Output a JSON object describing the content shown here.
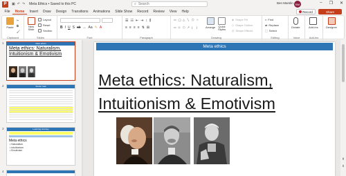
{
  "app": {
    "logo_letter": "P",
    "window_title": "Meta Ethics • Saved to this PC",
    "search_placeholder": "Search",
    "user_name": "Ben Marslin",
    "user_initials": "BM",
    "minimize": "–",
    "restore": "❐",
    "close": "✕"
  },
  "tabs": [
    "File",
    "Home",
    "Insert",
    "Draw",
    "Design",
    "Transitions",
    "Animations",
    "Slide Show",
    "Record",
    "Review",
    "View",
    "Help"
  ],
  "active_tab": "Home",
  "record_label": "Record",
  "share_label": "Share",
  "ribbon": {
    "clipboard": {
      "label": "Clipboard",
      "paste": "Paste"
    },
    "slides": {
      "label": "Slides",
      "new": "New\nSlide",
      "layout": "Layout",
      "reset": "Reset",
      "section": "Section"
    },
    "font": {
      "label": "Font"
    },
    "paragraph": {
      "label": "Paragraph"
    },
    "drawing": {
      "label": "Drawing",
      "arrange": "Arrange",
      "quick_styles": "Quick\nStyles",
      "shape_fill": "Shape Fill",
      "shape_outline": "Shape Outline",
      "shape_effects": "Shape Effects"
    },
    "editing": {
      "label": "Editing",
      "find": "Find",
      "replace": "Replace",
      "select": "Select"
    },
    "voice": {
      "label": "Voice",
      "dictate": "Dictate"
    },
    "addins": {
      "label": "Add-ins",
      "addins": "Add-ins"
    },
    "designer": {
      "label": "",
      "designer": "Designer"
    }
  },
  "thumbnails": [
    {
      "num": "1",
      "banner": "Meta ethics",
      "title": "Meta ethics: Naturalism, Intuitionism & Emotivism"
    },
    {
      "num": "2",
      "banner": "Starter task"
    },
    {
      "num": "3",
      "banner": "Learning Journey",
      "title": "Meta ethics",
      "bullets": [
        "• Naturalism",
        "• Intuitionism",
        "• Emotivism"
      ]
    },
    {
      "num": "4"
    }
  ],
  "slide": {
    "banner": "Meta ethics",
    "title": "Meta ethics: Naturalism, Intuitionism & Emotivism"
  }
}
